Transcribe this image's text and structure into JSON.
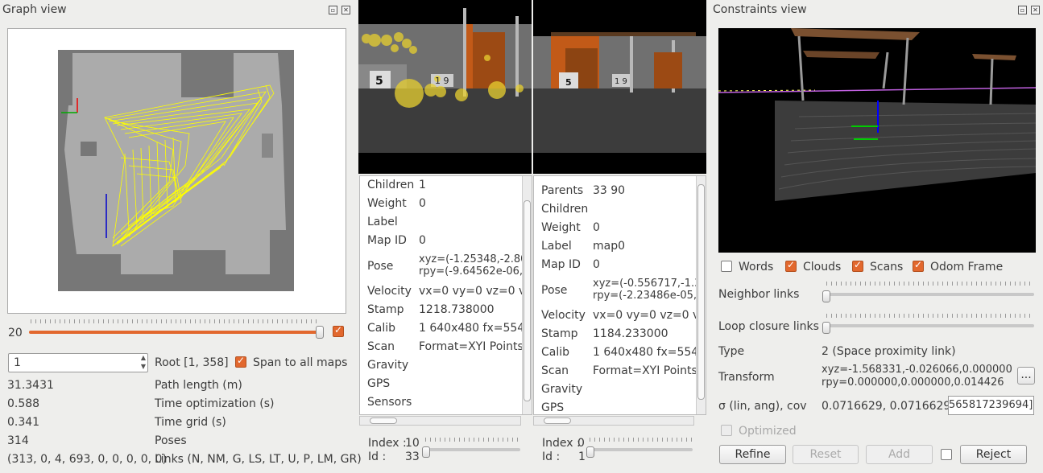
{
  "graph_view": {
    "title": "Graph view",
    "slider_value": "20",
    "slider_checked": true,
    "root_input": "1",
    "root_label": "Root [1, 358]",
    "span_label": "Span to all maps",
    "stats": [
      {
        "value": "31.3431",
        "label": "Path length (m)"
      },
      {
        "value": "0.588",
        "label": "Time optimization (s)"
      },
      {
        "value": "0.341",
        "label": "Time grid (s)"
      },
      {
        "value": "314",
        "label": "Poses"
      },
      {
        "value": "(313, 0, 4, 693, 0, 0, 0, 0, 0)",
        "label": "Links (N, NM, G, LS, LT, U, P, LM, GR)"
      }
    ]
  },
  "left_node": {
    "fields": [
      {
        "k": "Children",
        "v": "1"
      },
      {
        "k": "Weight",
        "v": "0"
      },
      {
        "k": "Label",
        "v": ""
      },
      {
        "k": "Map ID",
        "v": "0"
      },
      {
        "k": "Pose",
        "v": "xyz=(-1.25348,-2.80",
        "v2": "rpy=(-9.64562e-06,"
      },
      {
        "k": "Velocity",
        "v": "vx=0 vy=0 vz=0 vro"
      },
      {
        "k": "Stamp",
        "v": "1218.738000"
      },
      {
        "k": "Calib",
        "v": "1 640x480 fx=554.3"
      },
      {
        "k": "Scan",
        "v": "Format=XYI Points="
      },
      {
        "k": "Gravity",
        "v": ""
      },
      {
        "k": "GPS",
        "v": ""
      },
      {
        "k": "Sensors",
        "v": ""
      }
    ],
    "index_label": "Index :",
    "index_value": "10",
    "id_label": "Id :",
    "id_value": "33"
  },
  "right_node": {
    "fields": [
      {
        "k": "Parents",
        "v": "33 90"
      },
      {
        "k": "Children",
        "v": ""
      },
      {
        "k": "Weight",
        "v": "0"
      },
      {
        "k": "Label",
        "v": "map0"
      },
      {
        "k": "Map ID",
        "v": "0"
      },
      {
        "k": "Pose",
        "v": "xyz=(-0.556717,-1.3",
        "v2": "rpy=(-2.23486e-05,"
      },
      {
        "k": "Velocity",
        "v": "vx=0 vy=0 vz=0 vro"
      },
      {
        "k": "Stamp",
        "v": "1184.233000"
      },
      {
        "k": "Calib",
        "v": "1 640x480 fx=554.3"
      },
      {
        "k": "Scan",
        "v": "Format=XYI Points="
      },
      {
        "k": "Gravity",
        "v": ""
      },
      {
        "k": "GPS",
        "v": ""
      }
    ],
    "index_label": "Index :",
    "index_value": "0",
    "id_label": "Id :",
    "id_value": "1"
  },
  "constraints": {
    "title": "Constraints view",
    "checkboxes": [
      {
        "label": "Words",
        "checked": false
      },
      {
        "label": "Clouds",
        "checked": true
      },
      {
        "label": "Scans",
        "checked": true
      },
      {
        "label": "Odom Frame",
        "checked": true
      }
    ],
    "neighbor_links": "Neighbor links",
    "loop_closure_links": "Loop closure links",
    "type_label": "Type",
    "type_value": "2  (Space proximity link)",
    "transform_label": "Transform",
    "transform_line1": "xyz=-1.568331,-0.026066,0.000000",
    "transform_line2": "rpy=0.000000,0.000000,0.014426",
    "transform_button": "...",
    "cov_label": "σ (lin, ang), cov",
    "cov_value": "0.0716629, 0.0716629",
    "cov_field": "565817239694]",
    "optimized_label": "Optimized",
    "refine": "Refine",
    "reset": "Reset",
    "add": "Add",
    "reject": "Reject"
  },
  "colors": {
    "accent": "#e2682e",
    "graph_edges": "#ffff00",
    "map_free": "#aaaaaa",
    "map_unknown": "#777777"
  }
}
